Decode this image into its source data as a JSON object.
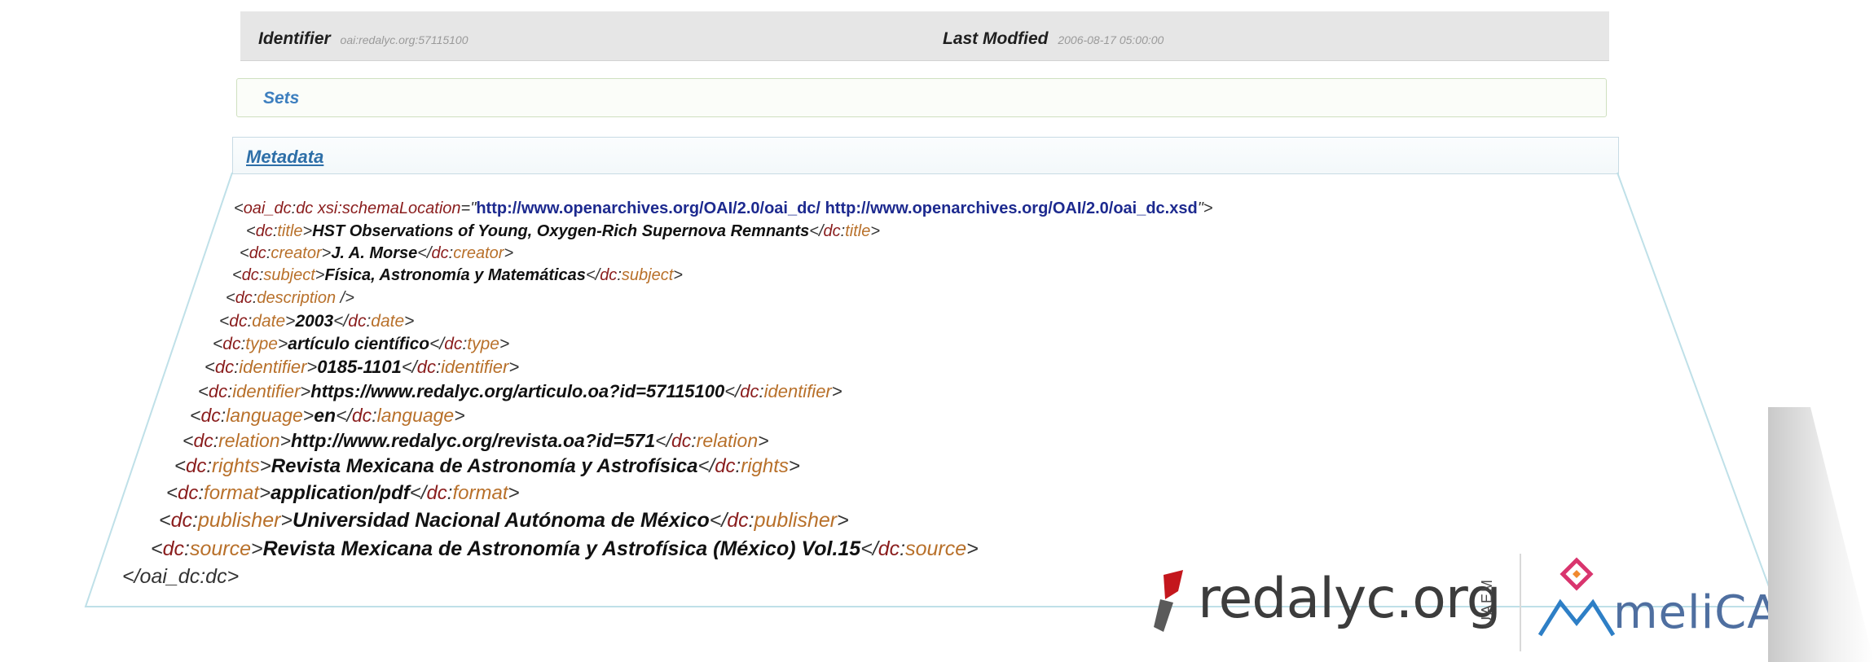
{
  "header": {
    "identifier_label": "Identifier",
    "identifier_value": "oai:redalyc.org:57115100",
    "modified_label": "Last Modfied",
    "modified_value": "2006-08-17 05:00:00"
  },
  "sets": {
    "title": "Sets"
  },
  "metadata": {
    "title": "Metadata",
    "root_open": {
      "prefix": "oai_dc",
      "name": "dc",
      "attr": "xsi:schemaLocation",
      "url1": "http://www.openarchives.org/OAI/2.0/oai_dc/",
      "url2": "http://www.openarchives.org/OAI/2.0/oai_dc.xsd"
    },
    "elements": [
      {
        "tag": "title",
        "value": "HST Observations of Young, Oxygen-Rich Supernova Remnants"
      },
      {
        "tag": "creator",
        "value": "J. A.  Morse"
      },
      {
        "tag": "subject",
        "value": "Física, Astronomía y Matemáticas"
      },
      {
        "tag": "description",
        "value": ""
      },
      {
        "tag": "date",
        "value": "2003"
      },
      {
        "tag": "type",
        "value": "artículo científico"
      },
      {
        "tag": "identifier",
        "value": "0185-1101"
      },
      {
        "tag": "identifier",
        "value": "https://www.redalyc.org/articulo.oa?id=57115100"
      },
      {
        "tag": "language",
        "value": "en"
      },
      {
        "tag": "relation",
        "value": "http://www.redalyc.org/revista.oa?id=571"
      },
      {
        "tag": "rights",
        "value": "Revista Mexicana de Astronomía y Astrofísica"
      },
      {
        "tag": "format",
        "value": "application/pdf"
      },
      {
        "tag": "publisher",
        "value": "Universidad Nacional Autónoma de México"
      },
      {
        "tag": "source",
        "value": "Revista Mexicana de Astronomía y Astrofísica (México) Vol.15"
      }
    ],
    "root_close": "</oai_dc:dc>"
  },
  "logos": {
    "redalyc": "redalyc.org",
    "uaem": "UAEM",
    "amelica": "meliCA"
  },
  "colors": {
    "tag_ns": "#8a1d1d",
    "tag_name": "#b8702a",
    "url": "#1d2a8f",
    "heading_blue": "#3d7fbf",
    "header_band": "#e6e6e6"
  }
}
